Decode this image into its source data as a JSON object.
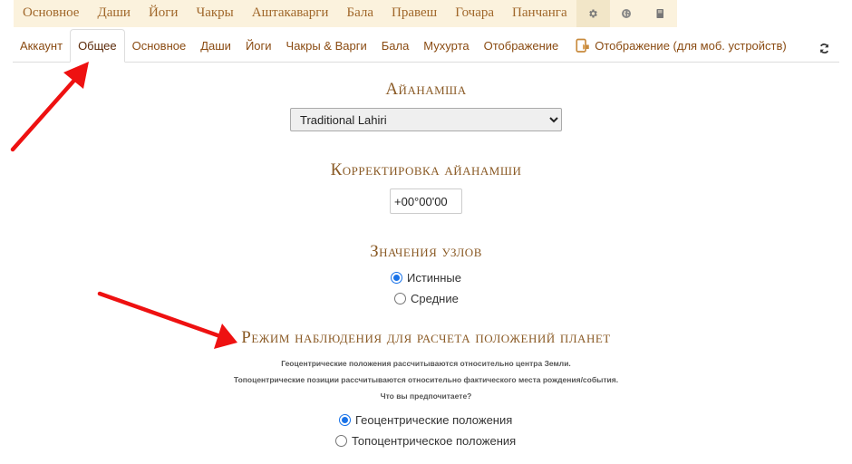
{
  "top_tabs": [
    {
      "label": "Основное"
    },
    {
      "label": "Даши"
    },
    {
      "label": "Йоги"
    },
    {
      "label": "Чакры"
    },
    {
      "label": "Аштакаварги"
    },
    {
      "label": "Бала"
    },
    {
      "label": "Правеш"
    },
    {
      "label": "Гочара"
    },
    {
      "label": "Панчанга"
    }
  ],
  "top_icons": [
    "gear-icon",
    "globe-icon",
    "book-icon"
  ],
  "sub_tabs": [
    {
      "label": "Аккаунт"
    },
    {
      "label": "Общее"
    },
    {
      "label": "Основное"
    },
    {
      "label": "Даши"
    },
    {
      "label": "Йоги"
    },
    {
      "label": "Чакры & Варги"
    },
    {
      "label": "Бала"
    },
    {
      "label": "Мухурта"
    },
    {
      "label": "Отображение"
    },
    {
      "label": "Отображение (для моб. устройств)"
    }
  ],
  "active_sub_tab": "Общее",
  "colors": {
    "accent": "#a0672a",
    "heading": "#8a5a25",
    "radio": "#1a73e8",
    "arrow": "#ee1111"
  },
  "ayanamsha": {
    "title": "Айанамша",
    "selected": "Traditional Lahiri"
  },
  "correction": {
    "title": "Корректировка айанамши",
    "value": "+00°00'00"
  },
  "nodes": {
    "title": "Значения узлов",
    "options": [
      {
        "label": "Истинные",
        "checked": true
      },
      {
        "label": "Средние",
        "checked": false
      }
    ]
  },
  "observation": {
    "title": "Режим наблюдения для расчета положений планет",
    "note1": "Геоцентрические положения рассчитываются относительно центра Земли.",
    "note2": "Топоцентрические позиции рассчитываются относительно фактического места рождения/события.",
    "note3": "Что вы предпочитаете?",
    "options": [
      {
        "label": "Геоцентрические положения",
        "checked": true
      },
      {
        "label": "Топоцентрическое положения",
        "checked": false
      }
    ]
  }
}
